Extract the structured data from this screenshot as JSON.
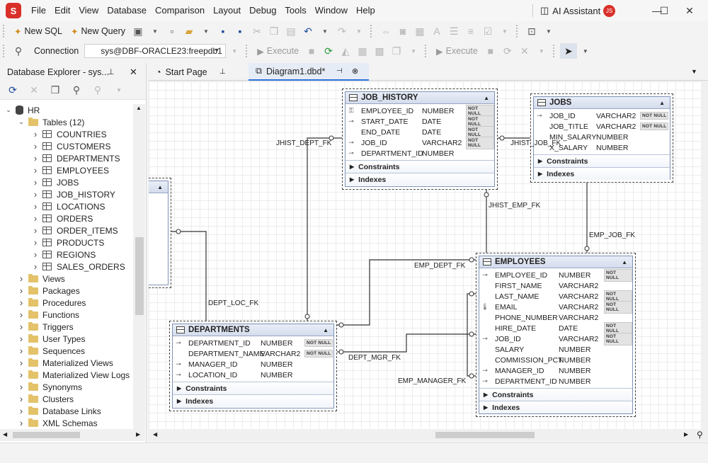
{
  "app": {
    "logo_letter": "S"
  },
  "menu": [
    "File",
    "Edit",
    "View",
    "Database",
    "Comparison",
    "Layout",
    "Debug",
    "Tools",
    "Window",
    "Help"
  ],
  "ai_assistant": {
    "label": "AI Assistant",
    "user_initials": "JS"
  },
  "toolbar1": {
    "new_sql": "New SQL",
    "new_query": "New Query"
  },
  "toolbar2": {
    "connection_label": "Connection",
    "connection_value": "sys@DBF-ORACLE23:freepdb1",
    "execute1": "Execute",
    "execute2": "Execute"
  },
  "explorer": {
    "title": "Database Explorer - sys...",
    "root": "HR",
    "tables_folder": "Tables (12)",
    "tables": [
      "COUNTRIES",
      "CUSTOMERS",
      "DEPARTMENTS",
      "EMPLOYEES",
      "JOBS",
      "JOB_HISTORY",
      "LOCATIONS",
      "ORDERS",
      "ORDER_ITEMS",
      "PRODUCTS",
      "REGIONS",
      "SALES_ORDERS"
    ],
    "folders": [
      "Views",
      "Packages",
      "Procedures",
      "Functions",
      "Triggers",
      "User Types",
      "Sequences",
      "Materialized Views",
      "Materialized View Logs",
      "Synonyms",
      "Clusters",
      "Database Links",
      "XML Schemas"
    ]
  },
  "tabs": {
    "start": "Start Page",
    "diagram": "Diagram1.dbd*"
  },
  "diagram": {
    "not_null": "NOT NULL",
    "constraints": "Constraints",
    "indexes": "Indexes",
    "job_history": {
      "title": "JOB_HISTORY",
      "columns": [
        {
          "name": "EMPLOYEE_ID",
          "type": "NUMBER",
          "nn": true
        },
        {
          "name": "START_DATE",
          "type": "DATE",
          "nn": true
        },
        {
          "name": "END_DATE",
          "type": "DATE",
          "nn": true
        },
        {
          "name": "JOB_ID",
          "type": "VARCHAR2",
          "nn": true
        },
        {
          "name": "DEPARTMENT_ID",
          "type": "NUMBER",
          "nn": false
        }
      ]
    },
    "jobs": {
      "title": "JOBS",
      "columns": [
        {
          "name": "JOB_ID",
          "type": "VARCHAR2",
          "nn": true
        },
        {
          "name": "JOB_TITLE",
          "type": "VARCHAR2",
          "nn": true
        },
        {
          "name": "MIN_SALARY",
          "type": "NUMBER",
          "nn": false
        },
        {
          "name": "X_SALARY",
          "type": "NUMBER",
          "nn": false
        }
      ]
    },
    "departments": {
      "title": "DEPARTMENTS",
      "columns": [
        {
          "name": "DEPARTMENT_ID",
          "type": "NUMBER",
          "nn": true
        },
        {
          "name": "DEPARTMENT_NAME",
          "type": "VARCHAR2",
          "nn": true
        },
        {
          "name": "MANAGER_ID",
          "type": "NUMBER",
          "nn": false
        },
        {
          "name": "LOCATION_ID",
          "type": "NUMBER",
          "nn": false
        }
      ]
    },
    "employees": {
      "title": "EMPLOYEES",
      "columns": [
        {
          "name": "EMPLOYEE_ID",
          "type": "NUMBER",
          "nn": true
        },
        {
          "name": "FIRST_NAME",
          "type": "VARCHAR2",
          "nn": false
        },
        {
          "name": "LAST_NAME",
          "type": "VARCHAR2",
          "nn": true
        },
        {
          "name": "EMAIL",
          "type": "VARCHAR2",
          "nn": true
        },
        {
          "name": "PHONE_NUMBER",
          "type": "VARCHAR2",
          "nn": false
        },
        {
          "name": "HIRE_DATE",
          "type": "DATE",
          "nn": true
        },
        {
          "name": "JOB_ID",
          "type": "VARCHAR2",
          "nn": true
        },
        {
          "name": "SALARY",
          "type": "NUMBER",
          "nn": false
        },
        {
          "name": "COMMISSION_PCT",
          "type": "NUMBER",
          "nn": false
        },
        {
          "name": "MANAGER_ID",
          "type": "NUMBER",
          "nn": false
        },
        {
          "name": "DEPARTMENT_ID",
          "type": "NUMBER",
          "nn": false
        }
      ]
    },
    "relations": {
      "jhist_dept": "JHIST_DEPT_FK",
      "jhist_job": "JHIST_JOB_FK",
      "jhist_emp": "JHIST_EMP_FK",
      "emp_job": "EMP_JOB_FK",
      "emp_dept": "EMP_DEPT_FK",
      "dept_loc": "DEPT_LOC_FK",
      "dept_mgr": "DEPT_MGR_FK",
      "emp_manager": "EMP_MANAGER_FK"
    }
  }
}
